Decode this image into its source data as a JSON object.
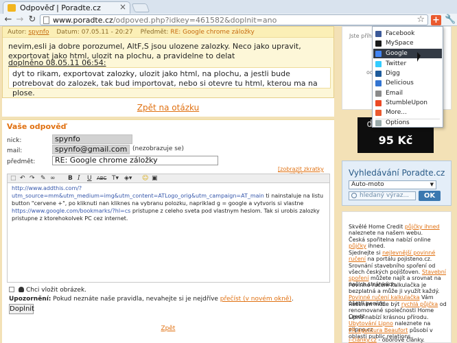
{
  "browser": {
    "tab_title": "Odpověď | Poradte.cz",
    "tab_close": "×",
    "url_domain": "www.poradte.cz",
    "url_path": "/odpoved.php?idkey=461582&doplnit=ano"
  },
  "post": {
    "author_label": "Autor:",
    "author": "spynfo",
    "date_label": "Datum:",
    "date": "07.05.11 - 20:27",
    "subject_label": "Předmět:",
    "subject": "RE: Google chrome záložky",
    "body": "nevim,esli ja dobre porozumel, AltF,S jsou ulozene zalozky. Neco jako upravit, exportovat jako html, ulozit na plochu, a pravidelne to delat",
    "edited": "doplněno 08.05.11 06:54:",
    "addendum": "dyt to rikam, exportovat zalozky, ulozit jako html, na plochu, a jestli bude potrebovat do zalozek, tak bud importovat, nebo si otevre tu html, kterou ma na plose."
  },
  "back_link": "Zpět na otázku",
  "reply": {
    "title": "Vaše odpověď",
    "nick_label": "nick:",
    "nick_value": "spynfo",
    "mail_label": "mail:",
    "mail_value": "spynfo@gmail.com",
    "mail_note": "(nezobrazuje se)",
    "subject_label": "předmět:",
    "subject_value": "RE: Google chrome záložky",
    "smileys_link": "[zobrazit zkratky smajlíků]",
    "editor_link_text": "http://www.addthis.com/?utm_source=mm&utm_medium=img&utm_content=ATLogo_orig&utm_campaign=AT_main",
    "editor_text_1": " ti nainstaluje na listu button \"cervene +\", po kliknuti nan kliknes na vybranu polozku, napriklad g = google a vytvoris si vlastne ",
    "editor_link_2": "https://www.google.com/bookmarks/?hl=cs",
    "editor_text_2": " pristupne z celeho sveta pod vlastnym heslom. Tak si urobis zalozky pristupne z ktorehokolvek PC cez internet.",
    "notify_label": "Chci vložit obrázek.",
    "warn_bold": "Upozornění:",
    "warn_text": " Pokud neznáte naše pravidla, nevahejte si je nejdříve ",
    "warn_link": "přečíst (v novém okně)",
    "warn_end": ".",
    "submit_label": "Doplnit",
    "bottom_link": "Zpět"
  },
  "editor_toolbar": {
    "undo": "↶",
    "redo": "↷",
    "bold": "B",
    "italic": "I",
    "underline": "U",
    "strike": "ABC"
  },
  "right": {
    "partial_1": "Jste příhlá",
    "partial_2": "odp",
    "ad_line_1": "doména .CZ",
    "ad_line_2": "95 Kč",
    "search_title": "Vyhledávání Poradte.cz",
    "search_select": "Auto-moto",
    "search_placeholder": "hledaný výraz...",
    "search_ok": "OK",
    "promos": [
      {
        "pre": "Skvělé Home Credit ",
        "link": "půjčky ihned",
        "post": " naleznete na našem webu."
      },
      {
        "pre": "Česká spořitelna nabízí online ",
        "link": "půjčky",
        "post": " ihned."
      },
      {
        "pre": "Sjednejte si ",
        "link": "nejlevnější povinné ručení",
        "post": " na portálu pojisteno.cz."
      },
      {
        "pre": "Srovnání stavebního spoření od všech českých pojišťoven. ",
        "link": "Stavební spoření",
        "post": " můžete najít a srovnat na našich stránkách."
      },
      {
        "pre": "Povinné ručení kalkulačka je bezplatná a může ji využít každý. ",
        "link": "Povinné ručení kalkulačka",
        "post": " Vám ušetří peníze."
      },
      {
        "pre": "Řešením může být ",
        "link": "rychlá půjčka",
        "post": " od renomované společnosti Home Credit."
      },
      {
        "pre": "Lipno nabízí krásnou přírodu. ",
        "link": "Ubytování Lipno",
        "post": " naleznete na elipno.cz"
      },
      {
        "pre": "",
        "link": "PR agentura Beaufort",
        "post": " působí v oblasti public relations."
      },
      {
        "pre": "",
        "link": "i-články.cz",
        "post": " - oborové články."
      }
    ]
  },
  "share_menu": {
    "items": [
      {
        "label": "Facebook",
        "color": "#3b5998"
      },
      {
        "label": "MySpace",
        "color": "#1a1a1a"
      },
      {
        "label": "Google",
        "color": "#4285f4"
      },
      {
        "label": "Twitter",
        "color": "#33ccff"
      },
      {
        "label": "Digg",
        "color": "#1d5a9a"
      },
      {
        "label": "Delicious",
        "color": "#3274d1"
      },
      {
        "label": "Email",
        "color": "#8a8a8a"
      },
      {
        "label": "StumbleUpon",
        "color": "#eb4924"
      },
      {
        "label": "More...",
        "color": "#ea5a2f"
      }
    ],
    "options": "Options",
    "selected": "Google"
  }
}
